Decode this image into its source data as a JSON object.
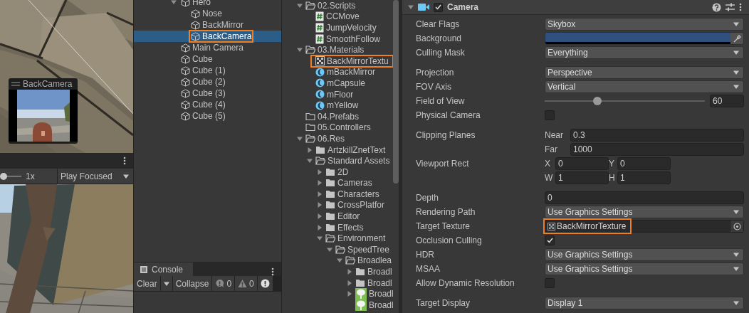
{
  "scene_view": {
    "overlay": {
      "title": "BackCamera"
    }
  },
  "game_view": {
    "zoom_slider": {
      "level": 0
    },
    "scale": "1x",
    "play_mode": "Play Focused"
  },
  "hierarchy": {
    "items": [
      {
        "name": "Hero",
        "expanded": true,
        "selected": false,
        "children": [
          {
            "name": "Nose",
            "selected": false
          },
          {
            "name": "BackMirror",
            "selected": false
          },
          {
            "name": "BackCamera",
            "selected": true,
            "highlighted": true
          }
        ]
      },
      {
        "name": "Main Camera",
        "selected": false
      },
      {
        "name": "Cube",
        "selected": false
      },
      {
        "name": "Cube (1)",
        "selected": false
      },
      {
        "name": "Cube (2)",
        "selected": false
      },
      {
        "name": "Cube (3)",
        "selected": false
      },
      {
        "name": "Cube (4)",
        "selected": false
      },
      {
        "name": "Cube (5)",
        "selected": false
      }
    ]
  },
  "console": {
    "title": "Console",
    "clear": "Clear",
    "collapse": "Collapse",
    "counts": [
      {
        "kind": "info",
        "count": "0"
      },
      {
        "kind": "warning",
        "count": "0"
      },
      {
        "kind": "error"
      }
    ]
  },
  "project": {
    "items": [
      {
        "name": "02.Scripts",
        "kind": "folder",
        "expanded": true,
        "children": [
          {
            "name": "CCMove",
            "kind": "script"
          },
          {
            "name": "JumpVelocity",
            "kind": "script"
          },
          {
            "name": "SmoothFollow",
            "kind": "script"
          }
        ]
      },
      {
        "name": "03.Materials",
        "kind": "folder",
        "expanded": true,
        "children": [
          {
            "name": "BackMirrorTextu",
            "kind": "texture",
            "highlighted": true
          },
          {
            "name": "mBackMirror",
            "kind": "material"
          },
          {
            "name": "mCapsule",
            "kind": "material"
          },
          {
            "name": "mFloor",
            "kind": "material"
          },
          {
            "name": "mYellow",
            "kind": "material"
          }
        ]
      },
      {
        "name": "04.Prefabs",
        "kind": "empty-folder"
      },
      {
        "name": "05.Controllers",
        "kind": "empty-folder"
      },
      {
        "name": "06.Res",
        "kind": "folder",
        "expanded": true,
        "children": [
          {
            "name": "ArtzkillZnetText",
            "kind": "folder",
            "expanded": false
          },
          {
            "name": "Standard Assets",
            "kind": "folder",
            "expanded": true,
            "children": [
              {
                "name": "2D",
                "kind": "folder",
                "expanded": false
              },
              {
                "name": "Cameras",
                "kind": "folder",
                "expanded": false
              },
              {
                "name": "Characters",
                "kind": "folder",
                "expanded": false
              },
              {
                "name": "CrossPlatfor",
                "kind": "folder",
                "expanded": false
              },
              {
                "name": "Editor",
                "kind": "folder",
                "expanded": false
              },
              {
                "name": "Effects",
                "kind": "folder",
                "expanded": false
              },
              {
                "name": "Environment",
                "kind": "folder",
                "expanded": true,
                "children": [
                  {
                    "name": "SpeedTree",
                    "kind": "folder",
                    "expanded": true,
                    "children": [
                      {
                        "name": "Broadlea",
                        "kind": "folder",
                        "expanded": true,
                        "children": [
                          {
                            "name": "Broadl",
                            "kind": "folder",
                            "expanded": false
                          },
                          {
                            "name": "Broadl",
                            "kind": "folder",
                            "expanded": false
                          },
                          {
                            "name": "Broadl",
                            "kind": "tree-asset",
                            "expanded": false
                          },
                          {
                            "name": "Broadl",
                            "kind": "tree-asset"
                          }
                        ]
                      }
                    ]
                  }
                ]
              }
            ]
          }
        ]
      }
    ]
  },
  "inspector": {
    "component": {
      "title": "Camera",
      "enabled": true,
      "expanded": true
    },
    "groups": [
      [
        {
          "kind": "dropdown",
          "label": "Clear Flags",
          "value": "Skybox"
        },
        {
          "kind": "color",
          "label": "Background",
          "color": "#30507e"
        },
        {
          "kind": "dropdown",
          "label": "Culling Mask",
          "value": "Everything"
        }
      ],
      [
        {
          "kind": "dropdown",
          "label": "Projection",
          "value": "Perspective"
        },
        {
          "kind": "dropdown",
          "label": "FOV Axis",
          "value": "Vertical"
        },
        {
          "kind": "slider",
          "label": "Field of View",
          "level": 0.33,
          "value": "60"
        },
        {
          "kind": "checkbox",
          "label": "Physical Camera",
          "checked": false
        }
      ],
      [
        {
          "kind": "fields",
          "label": "Clipping Planes",
          "fields": [
            {
              "label": "Near",
              "value": "0.3"
            },
            {
              "label": "Far",
              "value": "1000"
            }
          ]
        },
        {
          "kind": "rect",
          "label": "Viewport Rect",
          "fields": [
            {
              "label": "X",
              "value": "0"
            },
            {
              "label": "Y",
              "value": "0"
            },
            {
              "label": "W",
              "value": "1"
            },
            {
              "label": "H",
              "value": "1"
            }
          ]
        }
      ],
      [
        {
          "kind": "number",
          "label": "Depth",
          "value": "0"
        },
        {
          "kind": "dropdown",
          "label": "Rendering Path",
          "value": "Use Graphics Settings"
        },
        {
          "kind": "object",
          "label": "Target Texture",
          "value": "BackMirrorTexture",
          "highlighted": true
        },
        {
          "kind": "checkbox",
          "label": "Occlusion Culling",
          "checked": true
        },
        {
          "kind": "dropdown",
          "label": "HDR",
          "value": "Use Graphics Settings"
        },
        {
          "kind": "dropdown",
          "label": "MSAA",
          "value": "Use Graphics Settings"
        },
        {
          "kind": "checkbox",
          "label": "Allow Dynamic Resolution",
          "checked": false
        }
      ],
      [
        {
          "kind": "dropdown",
          "label": "Target Display",
          "value": "Display 1"
        }
      ]
    ]
  }
}
